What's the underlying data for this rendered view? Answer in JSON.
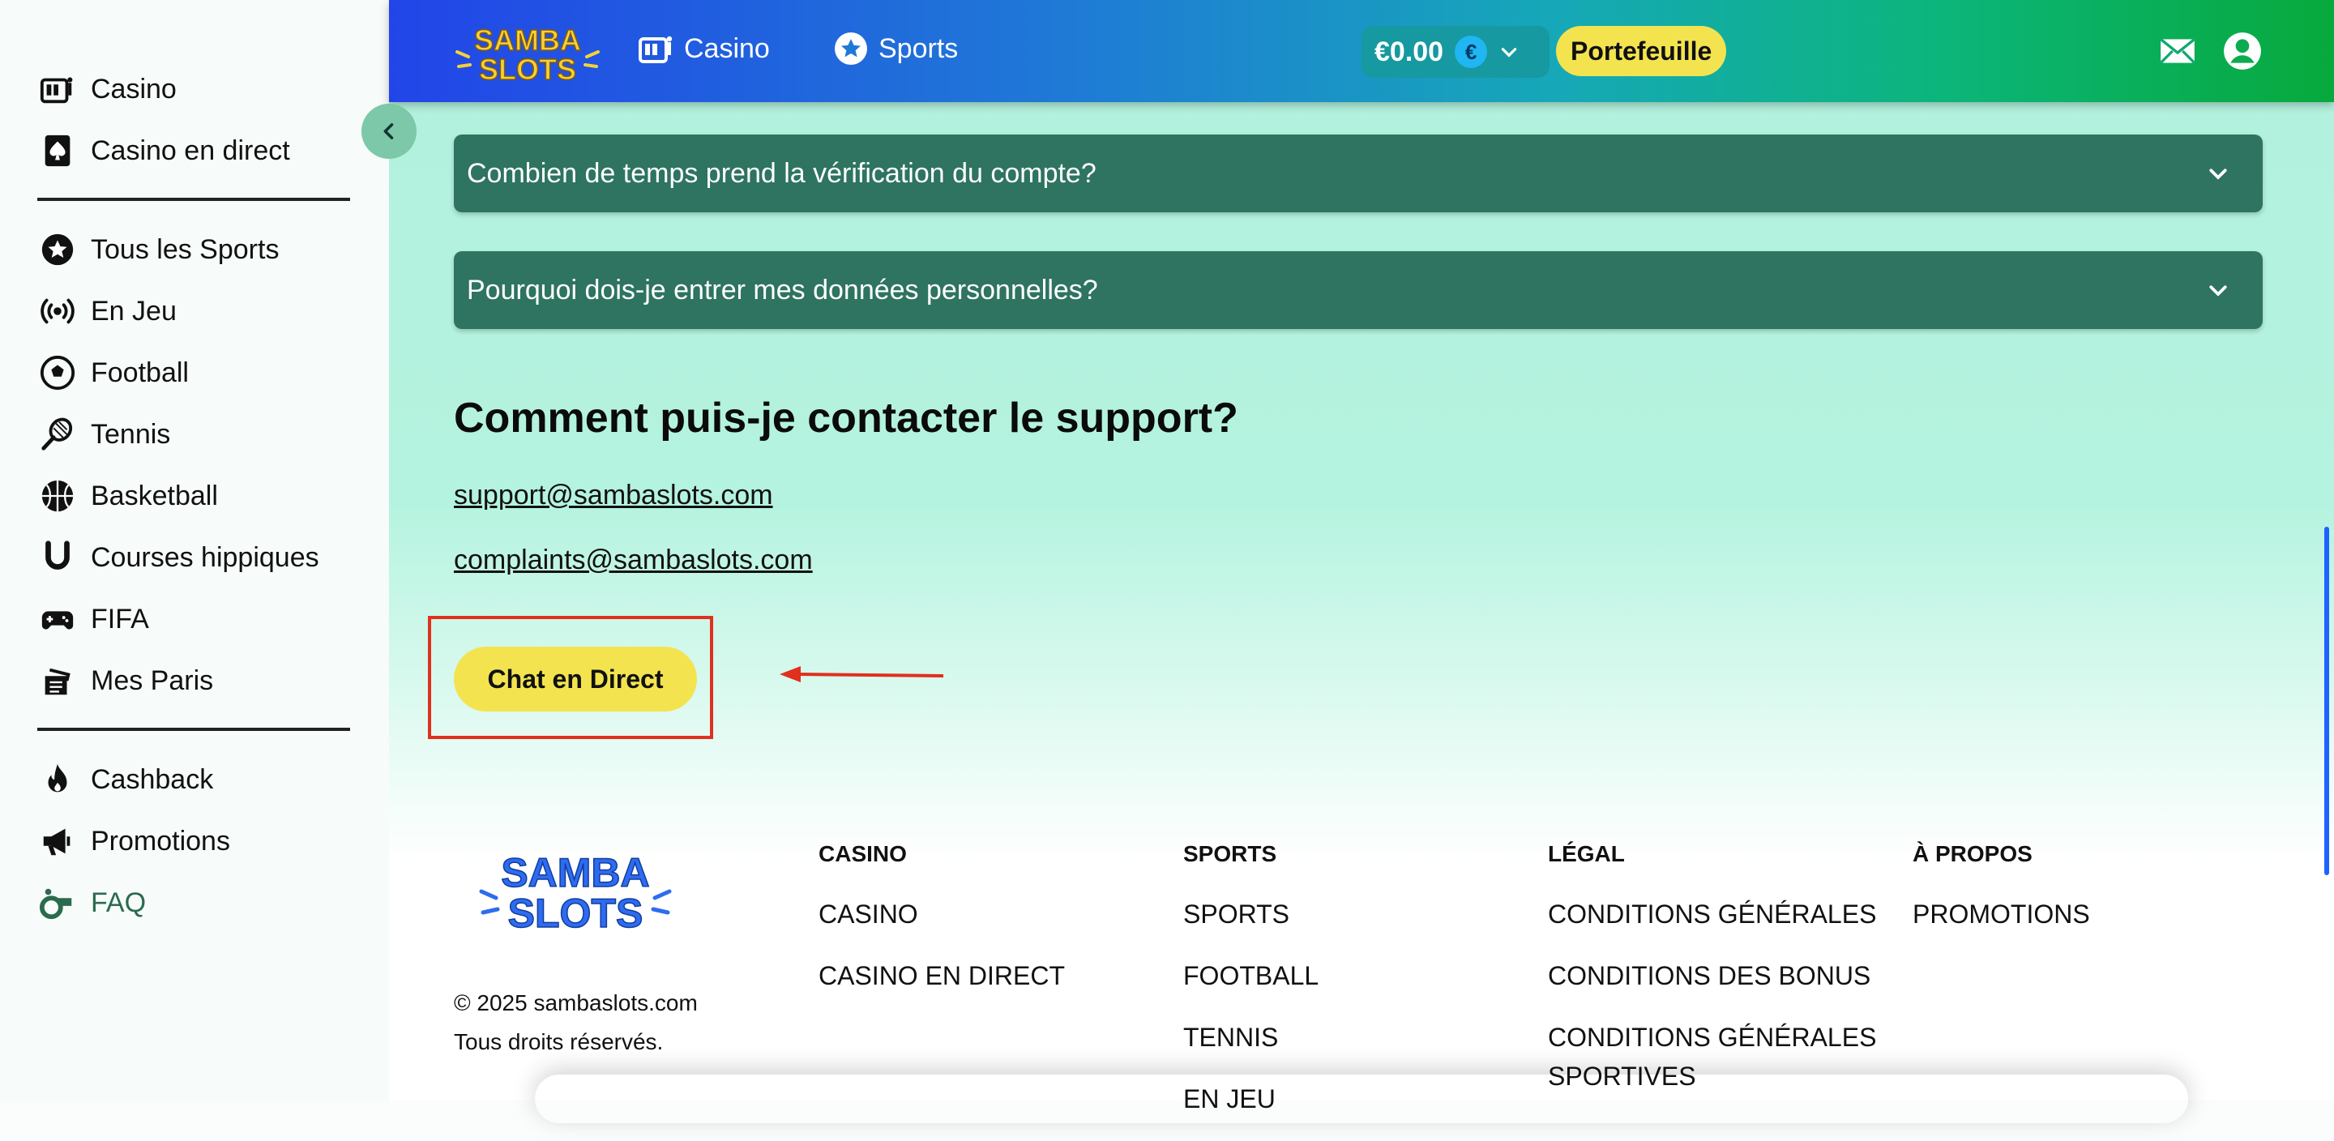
{
  "sidebar": {
    "group1": [
      {
        "label": "Casino",
        "icon": "slot-machine-icon"
      },
      {
        "label": "Casino en direct",
        "icon": "spade-card-icon"
      }
    ],
    "group2": [
      {
        "label": "Tous les Sports",
        "icon": "star-badge-icon"
      },
      {
        "label": "En Jeu",
        "icon": "live-broadcast-icon"
      },
      {
        "label": "Football",
        "icon": "football-icon"
      },
      {
        "label": "Tennis",
        "icon": "tennis-racket-icon"
      },
      {
        "label": "Basketball",
        "icon": "basketball-icon"
      },
      {
        "label": "Courses hippiques",
        "icon": "horseshoe-icon"
      },
      {
        "label": "FIFA",
        "icon": "gamepad-icon"
      },
      {
        "label": "Mes Paris",
        "icon": "tickets-icon"
      }
    ],
    "group3": [
      {
        "label": "Cashback",
        "icon": "flame-icon"
      },
      {
        "label": "Promotions",
        "icon": "megaphone-icon"
      },
      {
        "label": "FAQ",
        "icon": "whistle-icon"
      }
    ]
  },
  "topbar": {
    "logo_text": "SAMBA SLOTS",
    "nav": [
      {
        "label": "Casino",
        "icon": "slot-machine-icon"
      },
      {
        "label": "Sports",
        "icon": "star-badge-icon"
      }
    ],
    "balance": "€0.00",
    "currency_symbol": "€",
    "wallet_label": "Portefeuille"
  },
  "faq": {
    "items": [
      "Combien de temps prend la vérification du compte?",
      "Pourquoi dois-je entrer mes données personnelles?"
    ]
  },
  "support": {
    "heading": "Comment puis-je contacter le support?",
    "emails": [
      "support@sambaslots.com",
      "complaints@sambaslots.com"
    ],
    "chat_label": "Chat en Direct"
  },
  "footer": {
    "logo_text": "SAMBA SLOTS",
    "copyright": "© 2025 sambaslots.com",
    "rights": "Tous droits réservés.",
    "columns": [
      {
        "title": "CASINO",
        "links": [
          "CASINO",
          "CASINO EN DIRECT"
        ]
      },
      {
        "title": "SPORTS",
        "links": [
          "SPORTS",
          "FOOTBALL",
          "TENNIS",
          "EN JEU"
        ]
      },
      {
        "title": "LÉGAL",
        "links": [
          "CONDITIONS GÉNÉRALES",
          "CONDITIONS DES BONUS",
          "CONDITIONS GÉNÉRALES SPORTIVES"
        ]
      },
      {
        "title": "À PROPOS",
        "links": [
          "PROMOTIONS"
        ]
      }
    ]
  },
  "colors": {
    "accent_yellow": "#f3e34f",
    "faq_green": "#2e7460",
    "annotation_red": "#e0301e",
    "topbar_gradient_start": "#2245e8",
    "topbar_gradient_end": "#07a93c"
  }
}
